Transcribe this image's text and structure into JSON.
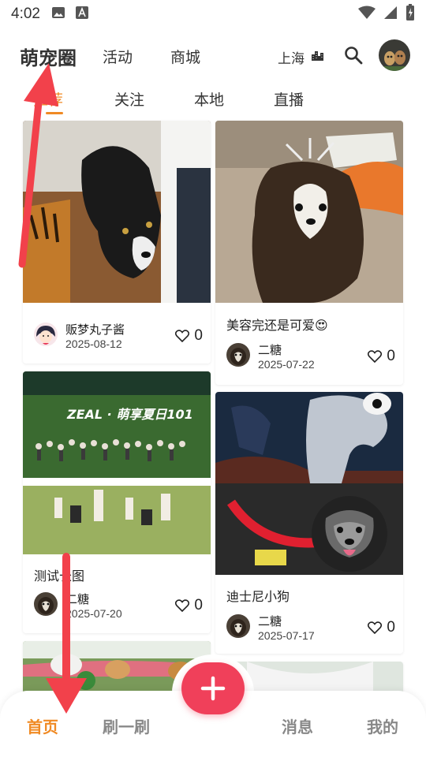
{
  "status_bar": {
    "time": "4:02"
  },
  "header": {
    "app_title": "萌宠圈",
    "nav_activity": "活动",
    "nav_mall": "商城",
    "city": "上海"
  },
  "tabs": [
    {
      "label": "推荐"
    },
    {
      "label": "关注"
    },
    {
      "label": "本地"
    },
    {
      "label": "直播"
    }
  ],
  "feed": {
    "left": [
      {
        "title": "",
        "author": "贩梦丸子酱",
        "date": "2025-08-12",
        "likes": "0"
      },
      {
        "title": "测试长图",
        "author": "二糖",
        "date": "2025-07-20",
        "likes": "0"
      }
    ],
    "right": [
      {
        "title": "美容完还是可爱😍",
        "author": "二糖",
        "date": "2025-07-22",
        "likes": "0"
      },
      {
        "title": "迪士尼小狗",
        "author": "二糖",
        "date": "2025-07-17",
        "likes": "0"
      }
    ],
    "banner_text": "ZEAL · 萌享夏日101"
  },
  "bottom_nav": {
    "home": "首页",
    "browse": "刷一刷",
    "messages": "消息",
    "mine": "我的"
  },
  "colors": {
    "accent": "#f08a24",
    "fab": "#f0405a",
    "annotation_arrow": "#f2414b"
  }
}
